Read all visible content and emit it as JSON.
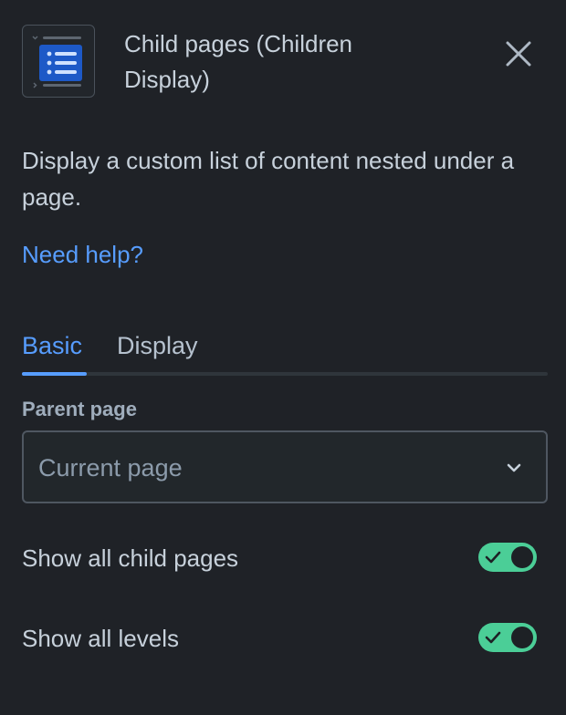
{
  "header": {
    "title": "Child pages (Children Display)",
    "icon": "list-icon",
    "close_icon": "close-icon"
  },
  "description": "Display a custom list of content nested under a page.",
  "help_link": "Need help?",
  "tabs": [
    {
      "label": "Basic",
      "active": true
    },
    {
      "label": "Display",
      "active": false
    }
  ],
  "parent_page": {
    "label": "Parent page",
    "value": "Current page",
    "icon": "chevron-down-icon"
  },
  "toggles": [
    {
      "label": "Show all child pages",
      "checked": true
    },
    {
      "label": "Show all levels",
      "checked": true
    }
  ],
  "colors": {
    "background": "#1f2227",
    "accent": "#579dff",
    "toggle_on": "#4bce97",
    "text": "#c7d1db"
  }
}
